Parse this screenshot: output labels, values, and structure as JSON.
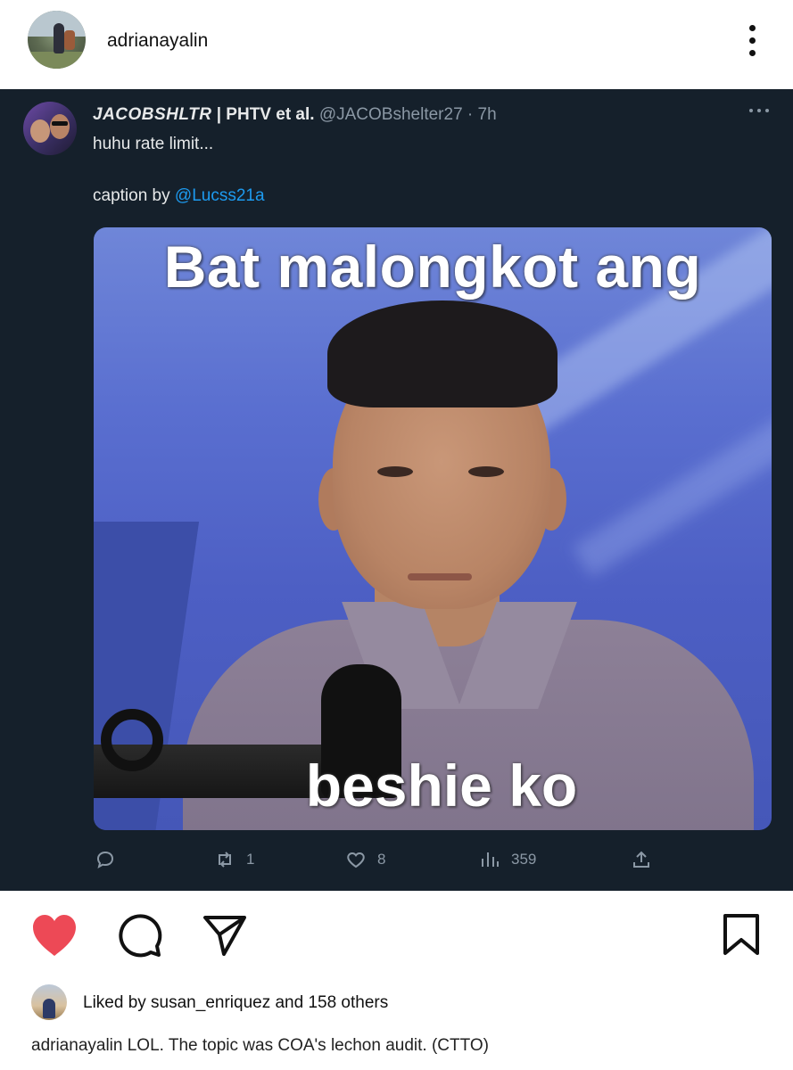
{
  "post": {
    "username": "adrianayalin",
    "more_icon": "more-vertical-icon"
  },
  "tweet": {
    "display_name": "JACOBSHLTR",
    "affiliation": " | PHTV et al.",
    "handle_time": " @JACOBshelter27 · 7h",
    "text_line1": "huhu rate limit...",
    "caption_prefix": "caption by ",
    "caption_mention": "@Lucss21a",
    "meme_top_text": "Bat malongkot ang",
    "meme_bottom_text": "beshie ko",
    "actions": {
      "reply_count": "",
      "retweet_count": "1",
      "like_count": "8",
      "views_count": "359"
    }
  },
  "likes": {
    "text": "Liked by susan_enriquez and 158 others"
  },
  "caption": {
    "text": "adrianayalin LOL. The topic was COA's lechon audit. (CTTO)"
  },
  "colors": {
    "tweet_bg": "#15202b",
    "twitter_blue": "#1d9bf0",
    "twitter_muted": "#8b98a5",
    "like_red": "#ed4956"
  }
}
